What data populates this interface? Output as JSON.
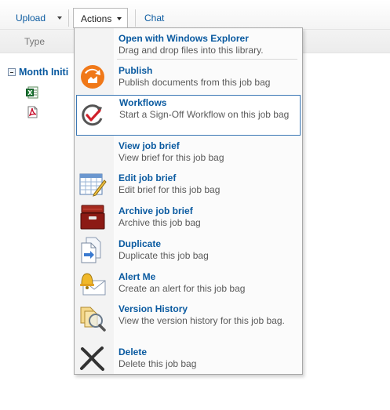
{
  "toolbar": {
    "upload_label": "Upload",
    "actions_label": "Actions",
    "chat_label": "Chat"
  },
  "list": {
    "column_type": "Type",
    "group_label": "Month Initi",
    "files": [
      {
        "icon": "excel-file-icon"
      },
      {
        "icon": "pdf-file-icon"
      }
    ]
  },
  "actions_menu": {
    "items": [
      {
        "title": "Open with Windows Explorer",
        "desc": "Drag and drop files into this library.",
        "icon": "none"
      },
      {
        "title": "Publish",
        "desc": "Publish documents from this job bag",
        "icon": "publish-icon"
      },
      {
        "title": "Workflows",
        "desc": "Start a Sign-Off Workflow on this job bag",
        "icon": "workflow-icon"
      },
      {
        "title": "View job brief",
        "desc": "View brief for this job bag",
        "icon": "none"
      },
      {
        "title": "Edit job brief",
        "desc": "Edit brief for this job bag",
        "icon": "edit-brief-icon"
      },
      {
        "title": "Archive job brief",
        "desc": "Archive this job bag",
        "icon": "archive-box-icon"
      },
      {
        "title": "Duplicate",
        "desc": "Duplicate this job bag",
        "icon": "duplicate-icon"
      },
      {
        "title": "Alert Me",
        "desc": "Create an alert for this job bag",
        "icon": "alert-bell-icon"
      },
      {
        "title": "Version History",
        "desc": "View the version history for this job bag.",
        "icon": "version-history-icon"
      },
      {
        "title": "Delete",
        "desc": "Delete this job bag",
        "icon": "delete-x-icon"
      }
    ],
    "selected_index": 2
  },
  "colors": {
    "link_blue": "#0a5aa0",
    "selection_border": "#3c78b5",
    "publish_orange": "#f07818",
    "archive_red": "#8c1a14"
  }
}
